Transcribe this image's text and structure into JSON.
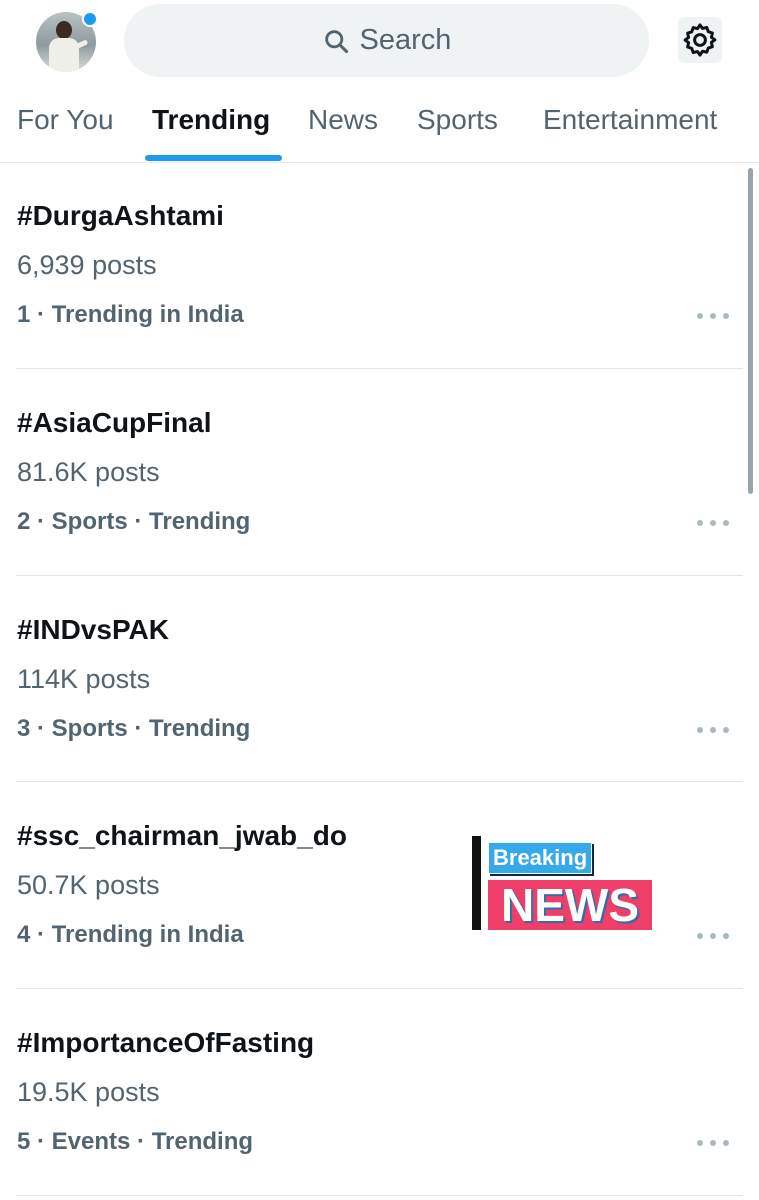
{
  "header": {
    "search_placeholder": "Search"
  },
  "tabs": [
    {
      "label": "For You",
      "active": false
    },
    {
      "label": "Trending",
      "active": true
    },
    {
      "label": "News",
      "active": false
    },
    {
      "label": "Sports",
      "active": false
    },
    {
      "label": "Entertainment",
      "active": false
    }
  ],
  "trends": [
    {
      "name": "#DurgaAshtami",
      "posts": "6,939 posts",
      "meta": "1 · Trending in India"
    },
    {
      "name": "#AsiaCupFinal",
      "posts": "81.6K posts",
      "meta": "2 · Sports · Trending"
    },
    {
      "name": "#INDvsPAK",
      "posts": "114K posts",
      "meta": "3 · Sports · Trending"
    },
    {
      "name": "#ssc_chairman_jwab_do",
      "posts": "50.7K posts",
      "meta": "4 · Trending in India"
    },
    {
      "name": "#ImportanceOfFasting",
      "posts": "19.5K posts",
      "meta": "5 · Events · Trending"
    }
  ],
  "breaking_graphic": {
    "top": "Breaking",
    "bottom": "NEWS"
  },
  "colors": {
    "accent": "#1d9bf0",
    "text_primary": "#0f1419",
    "text_secondary": "#536471",
    "search_bg": "#eff3f4"
  },
  "icons": {
    "search": "search-icon",
    "settings": "gear-icon",
    "more": "more-horizontal-icon"
  }
}
